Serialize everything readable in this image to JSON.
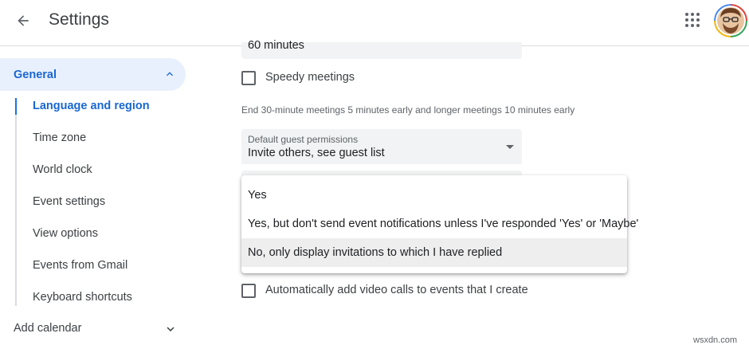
{
  "header": {
    "title": "Settings",
    "back_icon": "arrow-back-icon",
    "apps_icon": "apps-grid-icon"
  },
  "sidebar": {
    "general_label": "General",
    "items": [
      {
        "label": "Language and region",
        "active": true
      },
      {
        "label": "Time zone"
      },
      {
        "label": "World clock"
      },
      {
        "label": "Event settings"
      },
      {
        "label": "View options"
      },
      {
        "label": "Events from Gmail"
      },
      {
        "label": "Keyboard shortcuts"
      }
    ],
    "add_calendar_label": "Add calendar"
  },
  "content": {
    "partial_field_value": "60 minutes",
    "speedy_meetings_label": "Speedy meetings",
    "speedy_helper": "End 30-minute meetings 5 minutes early and longer meetings 10 minutes early",
    "guest_permissions": {
      "label": "Default guest permissions",
      "value": "Invite others, see guest list"
    },
    "auto_video_label": "Automatically add video calls to events that I create"
  },
  "dropdown": {
    "options": [
      "Yes",
      "Yes, but don't send event notifications unless I've responded 'Yes' or 'Maybe'",
      "No, only display invitations to which I have replied"
    ],
    "selected_index": 2
  },
  "watermark": "wsxdn.com",
  "colors": {
    "accent": "#1a73e8",
    "active_text": "#1967d2",
    "active_bg": "#e8f0fe"
  }
}
